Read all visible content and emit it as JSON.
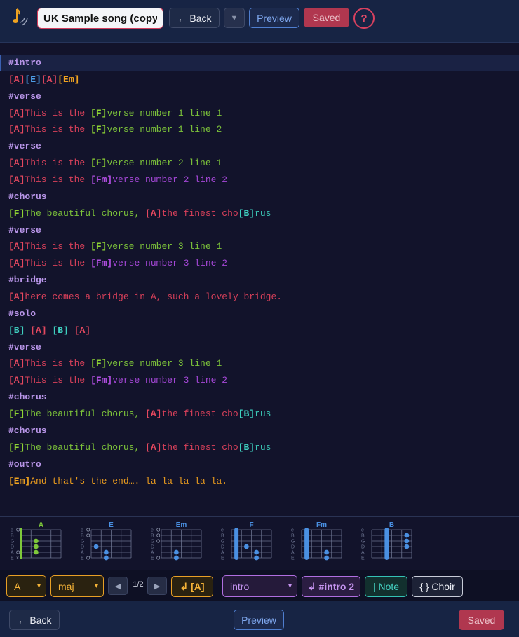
{
  "header": {
    "title_value": "UK Sample song (copy)",
    "back_label": "← Back",
    "dropdown_glyph": "▼",
    "preview_label": "Preview",
    "saved_label": "Saved",
    "help_label": "?"
  },
  "editor": {
    "lines": [
      {
        "type": "section",
        "text": "#intro"
      },
      {
        "type": "chords",
        "parts": [
          {
            "t": "[A]",
            "c": "ch-red"
          },
          {
            "t": "[E]",
            "c": "ch-blue"
          },
          {
            "t": "[A]",
            "c": "ch-red"
          },
          {
            "t": "[Em]",
            "c": "ch-orange"
          }
        ]
      },
      {
        "type": "section",
        "text": "#verse"
      },
      {
        "type": "lyric",
        "parts": [
          {
            "t": "[A]",
            "c": "ch-red"
          },
          {
            "t": "This is the ",
            "c": "ly-red"
          },
          {
            "t": "[F]",
            "c": "ch-green"
          },
          {
            "t": "verse number 1 line 1",
            "c": "ly-green"
          }
        ]
      },
      {
        "type": "lyric",
        "parts": [
          {
            "t": "[A]",
            "c": "ch-red"
          },
          {
            "t": "This is the ",
            "c": "ly-red"
          },
          {
            "t": "[F]",
            "c": "ch-green"
          },
          {
            "t": "verse number 1 line 2",
            "c": "ly-green"
          }
        ]
      },
      {
        "type": "section",
        "text": "#verse"
      },
      {
        "type": "lyric",
        "parts": [
          {
            "t": "[A]",
            "c": "ch-red"
          },
          {
            "t": "This is the ",
            "c": "ly-red"
          },
          {
            "t": "[F]",
            "c": "ch-green"
          },
          {
            "t": "verse number 2 line 1",
            "c": "ly-green"
          }
        ]
      },
      {
        "type": "lyric",
        "parts": [
          {
            "t": "[A]",
            "c": "ch-red"
          },
          {
            "t": "This is the ",
            "c": "ly-red"
          },
          {
            "t": "[Fm]",
            "c": "ch-purple"
          },
          {
            "t": "verse number 2 line 2",
            "c": "ly-purple"
          }
        ]
      },
      {
        "type": "section",
        "text": "#chorus"
      },
      {
        "type": "lyric",
        "parts": [
          {
            "t": "[F]",
            "c": "ch-green"
          },
          {
            "t": "The beautiful chorus, ",
            "c": "ly-green"
          },
          {
            "t": "[A]",
            "c": "ch-red"
          },
          {
            "t": "the finest cho",
            "c": "ly-red"
          },
          {
            "t": "[B]",
            "c": "ch-teal"
          },
          {
            "t": "rus",
            "c": "ly-teal"
          }
        ]
      },
      {
        "type": "section",
        "text": "#verse"
      },
      {
        "type": "lyric",
        "parts": [
          {
            "t": "[A]",
            "c": "ch-red"
          },
          {
            "t": "This is the ",
            "c": "ly-red"
          },
          {
            "t": "[F]",
            "c": "ch-green"
          },
          {
            "t": "verse number 3 line 1",
            "c": "ly-green"
          }
        ]
      },
      {
        "type": "lyric",
        "parts": [
          {
            "t": "[A]",
            "c": "ch-red"
          },
          {
            "t": "This is the ",
            "c": "ly-red"
          },
          {
            "t": "[Fm]",
            "c": "ch-purple"
          },
          {
            "t": "verse number 3 line 2",
            "c": "ly-purple"
          }
        ]
      },
      {
        "type": "section",
        "text": "#bridge"
      },
      {
        "type": "lyric",
        "parts": [
          {
            "t": "[A]",
            "c": "ch-red"
          },
          {
            "t": "here comes a bridge in A, such a lovely bridge.",
            "c": "ly-red"
          }
        ]
      },
      {
        "type": "section",
        "text": "#solo"
      },
      {
        "type": "chords",
        "parts": [
          {
            "t": "[B]",
            "c": "ch-teal"
          },
          {
            "t": " ",
            "c": "ly-teal"
          },
          {
            "t": "[A]",
            "c": "ch-red"
          },
          {
            "t": " ",
            "c": "ly-red"
          },
          {
            "t": "[B]",
            "c": "ch-teal"
          },
          {
            "t": " ",
            "c": "ly-teal"
          },
          {
            "t": "[A]",
            "c": "ch-red"
          }
        ]
      },
      {
        "type": "section",
        "text": "#verse"
      },
      {
        "type": "lyric",
        "parts": [
          {
            "t": "[A]",
            "c": "ch-red"
          },
          {
            "t": "This is the ",
            "c": "ly-red"
          },
          {
            "t": "[F]",
            "c": "ch-green"
          },
          {
            "t": "verse number 3 line 1",
            "c": "ly-green"
          }
        ]
      },
      {
        "type": "lyric",
        "parts": [
          {
            "t": "[A]",
            "c": "ch-red"
          },
          {
            "t": "This is the ",
            "c": "ly-red"
          },
          {
            "t": "[Fm]",
            "c": "ch-purple"
          },
          {
            "t": "verse number 3 line 2",
            "c": "ly-purple"
          }
        ]
      },
      {
        "type": "section",
        "text": "#chorus"
      },
      {
        "type": "lyric",
        "parts": [
          {
            "t": "[F]",
            "c": "ch-green"
          },
          {
            "t": "The beautiful chorus, ",
            "c": "ly-green"
          },
          {
            "t": "[A]",
            "c": "ch-red"
          },
          {
            "t": "the finest cho",
            "c": "ly-red"
          },
          {
            "t": "[B]",
            "c": "ch-teal"
          },
          {
            "t": "rus",
            "c": "ly-teal"
          }
        ]
      },
      {
        "type": "section",
        "text": "#chorus"
      },
      {
        "type": "lyric",
        "parts": [
          {
            "t": "[F]",
            "c": "ch-green"
          },
          {
            "t": "The beautiful chorus, ",
            "c": "ly-green"
          },
          {
            "t": "[A]",
            "c": "ch-red"
          },
          {
            "t": "the finest cho",
            "c": "ly-red"
          },
          {
            "t": "[B]",
            "c": "ch-teal"
          },
          {
            "t": "rus",
            "c": "ly-teal"
          }
        ]
      },
      {
        "type": "section",
        "text": "#outro"
      },
      {
        "type": "lyric",
        "parts": [
          {
            "t": "[Em]",
            "c": "ch-orange"
          },
          {
            "t": "And that's the end…. la la la la la.",
            "c": "ly-orange"
          }
        ]
      }
    ]
  },
  "chord_diagrams": {
    "string_labels": [
      "e",
      "B",
      "G",
      "D",
      "A",
      "E"
    ],
    "chords": [
      {
        "name": "A",
        "color": "#7ec83a",
        "indicators": [
          "O",
          "",
          "",
          "",
          "O",
          "×"
        ],
        "dots": [
          [
            2,
            1
          ],
          [
            3,
            1
          ],
          [
            4,
            1
          ]
        ],
        "barre": null,
        "nut": true
      },
      {
        "name": "E",
        "color": "#4a90e2",
        "indicators": [
          "O",
          "O",
          "",
          "",
          "",
          "O"
        ],
        "dots": [
          [
            3,
            0
          ],
          [
            4,
            1
          ],
          [
            5,
            1
          ]
        ],
        "barre": null,
        "nut": false
      },
      {
        "name": "Em",
        "color": "#4a90e2",
        "indicators": [
          "O",
          "O",
          "O",
          "",
          "",
          "O"
        ],
        "dots": [
          [
            4,
            1
          ],
          [
            5,
            1
          ]
        ],
        "barre": null,
        "nut": false
      },
      {
        "name": "F",
        "color": "#4a90e2",
        "indicators": [
          "",
          "",
          "",
          "",
          "",
          ""
        ],
        "dots": [
          [
            3,
            1
          ],
          [
            4,
            2
          ],
          [
            5,
            2
          ]
        ],
        "barre": 0,
        "nut": false
      },
      {
        "name": "Fm",
        "color": "#4a90e2",
        "indicators": [
          "",
          "",
          "",
          "",
          "",
          ""
        ],
        "dots": [
          [
            4,
            2
          ],
          [
            5,
            2
          ]
        ],
        "barre": 0,
        "nut": false
      },
      {
        "name": "B",
        "color": "#4a90e2",
        "indicators": [
          "",
          "",
          "",
          "",
          "",
          ""
        ],
        "dots": [
          [
            1,
            3
          ],
          [
            2,
            3
          ],
          [
            3,
            3
          ]
        ],
        "barre": 1,
        "nut": false
      }
    ]
  },
  "toolbar": {
    "key_value": "A",
    "quality_value": "maj",
    "prev_glyph": "◀",
    "next_glyph": "▶",
    "page_text": "1/2",
    "insert_chord_label": "↲ [A]",
    "section_value": "intro",
    "insert_section_label": "↲ #intro 2",
    "note_label": "| Note",
    "choir_label": "{ } Choir",
    "caret_glyph": "▾"
  },
  "footer": {
    "back_label": "← Back",
    "preview_label": "Preview",
    "saved_label": "Saved"
  },
  "colors": {
    "accent_orange": "#e8a025",
    "accent_purple": "#b06ee0",
    "accent_teal": "#34c2b4",
    "accent_blue": "#4f7ecf",
    "saved_red": "#b0374f"
  }
}
